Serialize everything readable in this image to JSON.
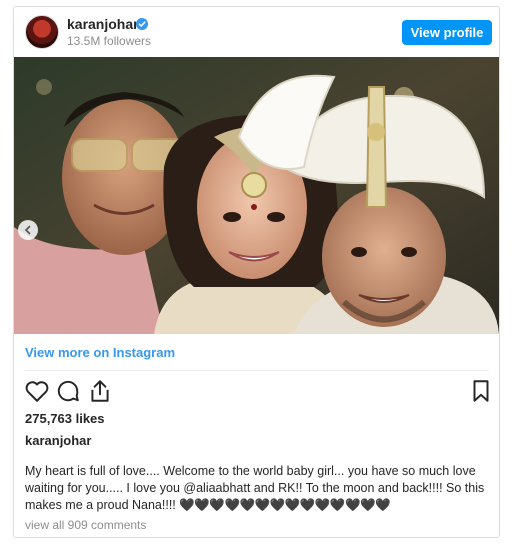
{
  "profile": {
    "username": "karanjohar",
    "followers": "13.5M followers",
    "view_profile_label": "View profile",
    "verified_icon": "verified-badge-icon"
  },
  "post": {
    "view_more_label": "View more on Instagram",
    "likes": "275,763 likes",
    "caption_user": "karanjohar",
    "caption_text": "My heart is full of love.... Welcome to the world baby girl... you have so much love waiting for you..... I love you @aliaabhatt and RK!! To the moon and back!!!! So this makes me a proud Nana!!!! ",
    "caption_hearts": "🖤🖤🖤🖤🖤🖤🖤🖤🖤🖤🖤🖤🖤🖤",
    "view_comments": "view all 909 comments"
  },
  "colors": {
    "accent": "#0095f6",
    "link": "#3897f0",
    "muted": "#8e8e8e",
    "text": "#262626",
    "border": "#dbdbdb"
  },
  "icons": [
    "heart-icon",
    "comment-icon",
    "share-icon",
    "bookmark-icon",
    "chevron-left-icon"
  ]
}
